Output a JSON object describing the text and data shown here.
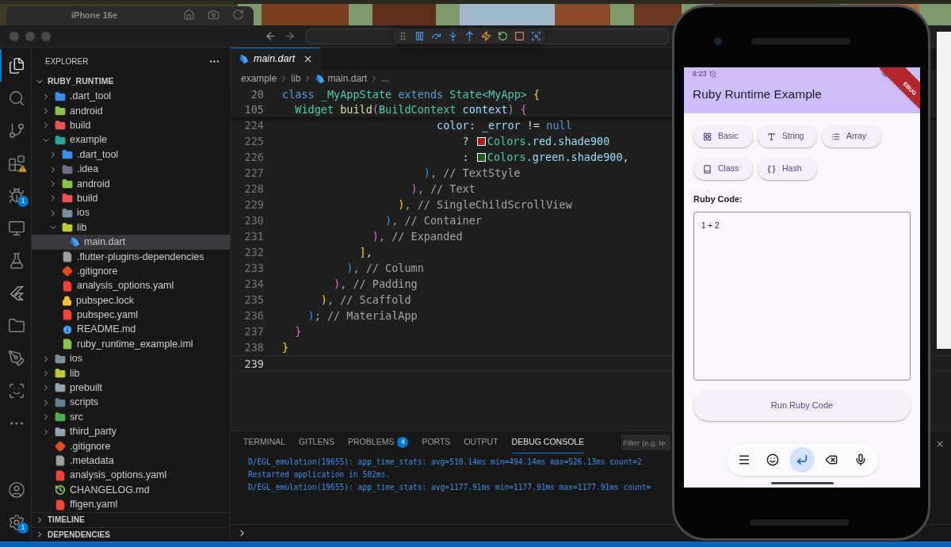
{
  "simulator_window": {
    "title": "iPhone 16e"
  },
  "activity_bar": [
    {
      "kind": "files",
      "selected": true,
      "warning": false
    },
    {
      "kind": "search",
      "selected": false,
      "warning": false
    },
    {
      "kind": "source-control",
      "selected": false,
      "warning": false
    },
    {
      "kind": "extensions",
      "selected": false,
      "warning": true
    },
    {
      "kind": "debug",
      "selected": false,
      "warning": false,
      "badge": "1"
    },
    {
      "kind": "remote",
      "selected": false,
      "warning": false
    },
    {
      "kind": "testing",
      "selected": false,
      "warning": false
    },
    {
      "kind": "flutter",
      "selected": false,
      "warning": false
    },
    {
      "kind": "folder",
      "selected": false,
      "warning": false
    },
    {
      "kind": "pen",
      "selected": false,
      "warning": false
    },
    {
      "kind": "scan",
      "selected": false,
      "warning": false
    },
    {
      "kind": "more",
      "selected": false,
      "warning": false
    }
  ],
  "activity_bar_bottom": [
    {
      "kind": "account",
      "selected": false,
      "warning": false
    },
    {
      "kind": "settings",
      "selected": false,
      "warning": false,
      "badge": "1"
    }
  ],
  "sidebar": {
    "title": "EXPLORER",
    "root": {
      "name": "RUBY_RUNTIME",
      "expanded": true,
      "children": [
        {
          "name": ".dart_tool",
          "kind": "folder",
          "color": "#3b8eea",
          "expanded": false,
          "selected": false
        },
        {
          "name": "android",
          "kind": "folder",
          "color": "#8bc34a",
          "expanded": false,
          "selected": false
        },
        {
          "name": "build",
          "kind": "folder",
          "color": "#ef5350",
          "expanded": false,
          "selected": false
        },
        {
          "name": "example",
          "kind": "folder",
          "color": "#26a69a",
          "expanded": true,
          "selected": false,
          "children": [
            {
              "name": ".dart_tool",
              "kind": "folder",
              "color": "#3b8eea",
              "expanded": false,
              "selected": false
            },
            {
              "name": ".idea",
              "kind": "folder",
              "color": "#6d6f8a",
              "expanded": false,
              "selected": false
            },
            {
              "name": "android",
              "kind": "folder",
              "color": "#8bc34a",
              "expanded": false,
              "selected": false
            },
            {
              "name": "build",
              "kind": "folder",
              "color": "#ef5350",
              "expanded": false,
              "selected": false
            },
            {
              "name": "ios",
              "kind": "folder",
              "color": "#78909c",
              "expanded": false,
              "selected": false
            },
            {
              "name": "lib",
              "kind": "folder",
              "color": "#c0ca33",
              "expanded": true,
              "selected": false,
              "children": [
                {
                  "name": "main.dart",
                  "kind": "dart",
                  "color": "#42a5f5",
                  "selected": true
                }
              ]
            },
            {
              "name": ".flutter-plugins-dependencies",
              "kind": "file",
              "color": "#9e9e9e",
              "selected": false
            },
            {
              "name": ".gitignore",
              "kind": "git",
              "color": "#e64a19",
              "selected": false
            },
            {
              "name": "analysis_options.yaml",
              "kind": "file",
              "color": "#f44336",
              "selected": false
            },
            {
              "name": "pubspec.lock",
              "kind": "lock",
              "color": "#fbc02d",
              "selected": false
            },
            {
              "name": "pubspec.yaml",
              "kind": "file",
              "color": "#f44336",
              "selected": false
            },
            {
              "name": "README.md",
              "kind": "info",
              "color": "#42a5f5",
              "selected": false
            },
            {
              "name": "ruby_runtime_example.iml",
              "kind": "file",
              "color": "#8bc34a",
              "selected": false
            }
          ]
        },
        {
          "name": "ios",
          "kind": "folder",
          "color": "#78909c",
          "expanded": false,
          "selected": false
        },
        {
          "name": "lib",
          "kind": "folder",
          "color": "#c0ca33",
          "expanded": false,
          "selected": false
        },
        {
          "name": "prebuilt",
          "kind": "folder",
          "color": "#90a4ae",
          "expanded": false,
          "selected": false
        },
        {
          "name": "scripts",
          "kind": "folder",
          "color": "#607d8b",
          "expanded": false,
          "selected": false
        },
        {
          "name": "src",
          "kind": "folder",
          "color": "#4caf50",
          "expanded": false,
          "selected": false
        },
        {
          "name": "third_party",
          "kind": "folder",
          "color": "#90a4ae",
          "expanded": false,
          "selected": false
        },
        {
          "name": ".gitignore",
          "kind": "git",
          "color": "#e64a19",
          "selected": false
        },
        {
          "name": ".metadata",
          "kind": "file",
          "color": "#9e9e9e",
          "selected": false
        },
        {
          "name": "analysis_options.yaml",
          "kind": "file",
          "color": "#f44336",
          "selected": false
        },
        {
          "name": "CHANGELOG.md",
          "kind": "history",
          "color": "#8bc34a",
          "selected": false
        },
        {
          "name": "ffigen.yaml",
          "kind": "file",
          "color": "#f44336",
          "selected": false
        }
      ]
    },
    "sections": [
      {
        "name": "TIMELINE",
        "expanded": false
      },
      {
        "name": "DEPENDENCIES",
        "expanded": false
      }
    ]
  },
  "debug_toolbar": [
    {
      "kind": "grip"
    },
    {
      "kind": "pause"
    },
    {
      "kind": "step-over"
    },
    {
      "kind": "step-into"
    },
    {
      "kind": "step-out"
    },
    {
      "kind": "hot-reload"
    },
    {
      "kind": "restart"
    },
    {
      "kind": "stop"
    },
    {
      "kind": "inspect"
    }
  ],
  "tabs": [
    {
      "label": "main.dart",
      "selected": true
    }
  ],
  "breadcrumbs": [
    {
      "text": "example",
      "kind": "folder"
    },
    {
      "text": "lib",
      "kind": "folder"
    },
    {
      "text": "main.dart",
      "kind": "dart"
    },
    {
      "text": "...",
      "kind": "more"
    }
  ],
  "sticky_lines": [
    {
      "number": "20",
      "tokens": [
        {
          "kind": "kw",
          "text": "class "
        },
        {
          "kind": "type",
          "text": "_MyAppState "
        },
        {
          "kind": "kw",
          "text": "extends "
        },
        {
          "kind": "type",
          "text": "State<MyApp> "
        },
        {
          "kind": "b1",
          "text": "{"
        }
      ]
    },
    {
      "number": "105",
      "tokens": [
        {
          "kind": "type",
          "text": "  Widget "
        },
        {
          "kind": "func",
          "text": "build"
        },
        {
          "kind": "b2",
          "text": "("
        },
        {
          "kind": "type",
          "text": "BuildContext "
        },
        {
          "kind": "var",
          "text": "context"
        },
        {
          "kind": "b2",
          "text": ") {"
        }
      ]
    }
  ],
  "code_lines": [
    {
      "number": "224",
      "current": false,
      "tokens": [
        {
          "kind": "var",
          "text": "                        color: _error"
        },
        {
          "kind": "plain",
          "text": " != "
        },
        {
          "kind": "kw",
          "text": "null"
        }
      ]
    },
    {
      "number": "225",
      "current": false,
      "tokens": [
        {
          "kind": "plain",
          "text": "                            ? "
        },
        {
          "kind": "swatch",
          "color": "#b71c1c"
        },
        {
          "kind": "type",
          "text": "Colors"
        },
        {
          "kind": "var",
          "text": ".red.shade900"
        }
      ]
    },
    {
      "number": "226",
      "current": false,
      "tokens": [
        {
          "kind": "plain",
          "text": "                            : "
        },
        {
          "kind": "swatch",
          "color": "#1b5e20"
        },
        {
          "kind": "type",
          "text": "Colors"
        },
        {
          "kind": "var",
          "text": ".green.shade900"
        },
        {
          "kind": "plain",
          "text": ","
        }
      ]
    },
    {
      "number": "227",
      "current": false,
      "tokens": [
        {
          "kind": "b3",
          "text": "                      )"
        },
        {
          "kind": "comment",
          "text": ", // TextStyle"
        }
      ]
    },
    {
      "number": "228",
      "current": false,
      "tokens": [
        {
          "kind": "b2",
          "text": "                    )"
        },
        {
          "kind": "comment",
          "text": ", // Text"
        }
      ]
    },
    {
      "number": "229",
      "current": false,
      "tokens": [
        {
          "kind": "b1",
          "text": "                  )"
        },
        {
          "kind": "comment",
          "text": ", // SingleChildScrollView"
        }
      ]
    },
    {
      "number": "230",
      "current": false,
      "tokens": [
        {
          "kind": "b3",
          "text": "                )"
        },
        {
          "kind": "comment",
          "text": ", // Container"
        }
      ]
    },
    {
      "number": "231",
      "current": false,
      "tokens": [
        {
          "kind": "b2",
          "text": "              )"
        },
        {
          "kind": "comment",
          "text": ", // Expanded"
        }
      ]
    },
    {
      "number": "232",
      "current": false,
      "tokens": [
        {
          "kind": "b1",
          "text": "            ]"
        },
        {
          "kind": "plain",
          "text": ","
        }
      ]
    },
    {
      "number": "233",
      "current": false,
      "tokens": [
        {
          "kind": "b3",
          "text": "          )"
        },
        {
          "kind": "comment",
          "text": ", // Column"
        }
      ]
    },
    {
      "number": "234",
      "current": false,
      "tokens": [
        {
          "kind": "b2",
          "text": "        )"
        },
        {
          "kind": "comment",
          "text": ", // Padding"
        }
      ]
    },
    {
      "number": "235",
      "current": false,
      "tokens": [
        {
          "kind": "b1",
          "text": "      )"
        },
        {
          "kind": "comment",
          "text": ", // Scaffold"
        }
      ]
    },
    {
      "number": "236",
      "current": false,
      "tokens": [
        {
          "kind": "b3",
          "text": "    )"
        },
        {
          "kind": "comment",
          "text": "; // MaterialApp"
        }
      ]
    },
    {
      "number": "237",
      "current": false,
      "tokens": [
        {
          "kind": "b2",
          "text": "  }"
        }
      ]
    },
    {
      "number": "238",
      "current": false,
      "tokens": [
        {
          "kind": "b1",
          "text": "}"
        }
      ]
    },
    {
      "number": "239",
      "current": true
    }
  ],
  "panel": {
    "tabs": [
      {
        "label": "TERMINAL",
        "selected": false
      },
      {
        "label": "GITLENS",
        "selected": false
      },
      {
        "label": "PROBLEMS",
        "selected": false,
        "badge": "4"
      },
      {
        "label": "PORTS",
        "selected": false
      },
      {
        "label": "OUTPUT",
        "selected": false
      },
      {
        "label": "DEBUG CONSOLE",
        "selected": true
      }
    ],
    "filter_placeholder": "Filter (e.g. te",
    "console": [
      "D/EGL_emulation(19655): app_time_stats: avg=510.14ms min=494.14ms max=526.13ms count=2",
      "Restarted application in 502ms.",
      "D/EGL_emulation(19655): app_time_stats: avg=1177.91ms min=1177.91ms max=1177.91ms count="
    ]
  },
  "phone": {
    "time": "8:23",
    "banner": "EBUG",
    "title": "Ruby Runtime Example",
    "chips": [
      {
        "label": "Basic",
        "kind": "grid"
      },
      {
        "label": "String",
        "kind": "text"
      },
      {
        "label": "Array",
        "kind": "list"
      },
      {
        "label": "Class",
        "kind": "book"
      },
      {
        "label": "Hash",
        "kind": "braces"
      }
    ],
    "code_label": "Ruby Code:",
    "code": "1 + 2",
    "run_button": "Run Ruby Code",
    "keyboard": [
      {
        "kind": "menu",
        "selected": false
      },
      {
        "kind": "emoji",
        "selected": false
      },
      {
        "kind": "enter",
        "selected": true
      },
      {
        "kind": "backspace",
        "selected": false
      },
      {
        "kind": "mic",
        "selected": false
      }
    ]
  }
}
